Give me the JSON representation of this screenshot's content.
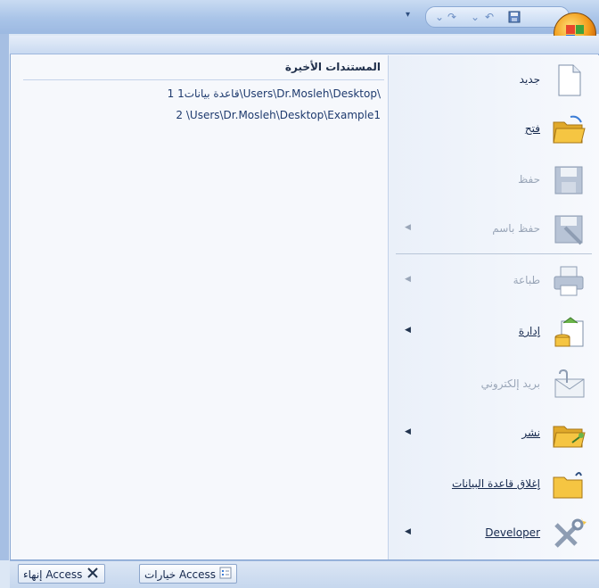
{
  "quick_access": {
    "icons": [
      "save-icon",
      "undo-icon",
      "redo-icon",
      "customize-icon"
    ]
  },
  "recent": {
    "title": "المستندات الأخيرة",
    "items": [
      {
        "text": "1 قاعدة بيانات1\\Users\\Dr.Mosleh\\Desktop\\"
      },
      {
        "text": "2 \\Users\\Dr.Mosleh\\Desktop\\Example1"
      }
    ]
  },
  "menu": {
    "items": [
      {
        "label": "جديد",
        "icon": "new-document-icon",
        "enabled": true,
        "submenu": false
      },
      {
        "label": "فتح",
        "icon": "open-folder-icon",
        "enabled": true,
        "submenu": false
      },
      {
        "label": "حفظ",
        "icon": "save-icon",
        "enabled": false,
        "submenu": false
      },
      {
        "label": "حفظ باسم",
        "icon": "save-as-icon",
        "enabled": false,
        "submenu": true
      },
      {
        "label": "طباعة",
        "icon": "print-icon",
        "enabled": false,
        "submenu": true
      },
      {
        "label": "إدارة",
        "icon": "manage-icon",
        "enabled": true,
        "submenu": true
      },
      {
        "label": "بريد إلكتروني",
        "icon": "email-icon",
        "enabled": false,
        "submenu": false
      },
      {
        "label": "نشر",
        "icon": "publish-icon",
        "enabled": true,
        "submenu": true
      },
      {
        "label": "إغلاق قاعدة البيانات",
        "icon": "close-database-icon",
        "enabled": true,
        "submenu": false
      },
      {
        "label": "Developer",
        "icon": "developer-tools-icon",
        "enabled": true,
        "submenu": true
      }
    ]
  },
  "footer": {
    "options_label": "خيارات Access",
    "exit_label": "إنهاء Access"
  },
  "colors": {
    "accent_orange": "#f29b1a",
    "folder_yellow": "#f5c542",
    "text_dark": "#15284d",
    "disabled_text": "#9aa6b8"
  }
}
